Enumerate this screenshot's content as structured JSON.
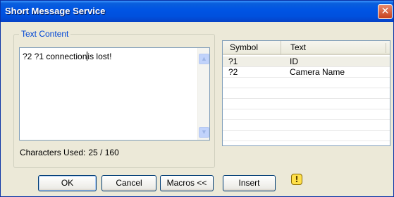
{
  "window": {
    "title": "Short Message Service",
    "close_glyph": "✕"
  },
  "text_content": {
    "legend": "Text Content",
    "value_before_caret": "?2 ?1 connection",
    "value_after_caret": "is lost!",
    "chars_used_label": "Characters Used:",
    "chars_used_value": "25 / 160"
  },
  "symbol_list": {
    "columns": [
      "Symbol",
      "Text"
    ],
    "rows": [
      {
        "symbol": "?1",
        "text": "ID"
      },
      {
        "symbol": "?2",
        "text": "Camera Name"
      }
    ],
    "selected_row": 0
  },
  "buttons": {
    "ok": "OK",
    "cancel": "Cancel",
    "macros": "Macros <<",
    "insert": "Insert"
  },
  "icons": {
    "warning": "warning-icon",
    "scroll_up": "▲",
    "scroll_down": "▼",
    "warning_glyph": "!"
  },
  "colors": {
    "title_bar": "#0054e3",
    "selected_row": "#f0efe6",
    "legend_text": "#0046d5"
  }
}
